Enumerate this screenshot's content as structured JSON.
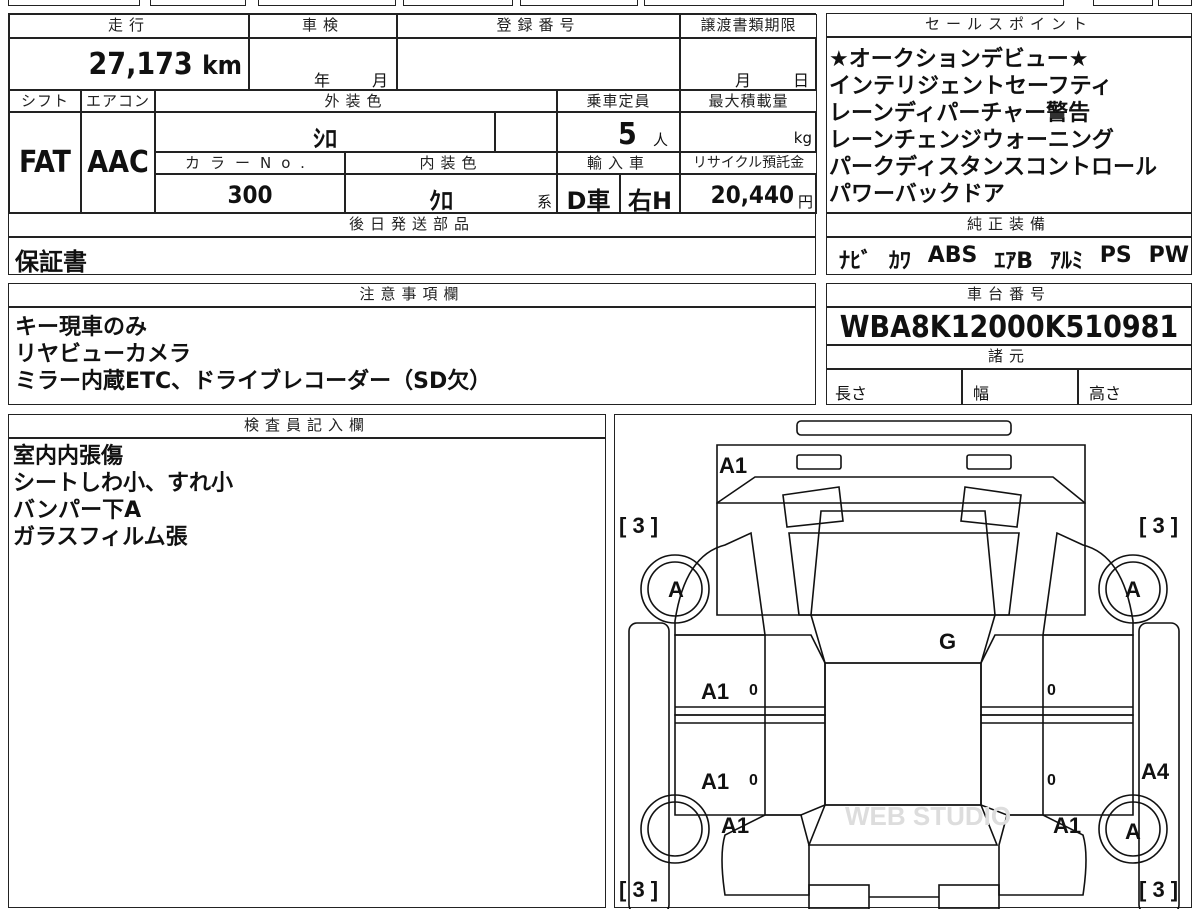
{
  "top": {
    "mileage_label": "走行",
    "mileage_value": "27,173",
    "mileage_unit": "km",
    "inspection_label": "車検",
    "inspection_year": "年",
    "inspection_month": "月",
    "registration_label": "登録番号",
    "registration_value": "",
    "transfer_label": "譲渡書類期限",
    "transfer_month": "月",
    "transfer_day": "日"
  },
  "spec": {
    "shift_label": "シフト",
    "shift_value": "FAT",
    "ac_label": "エアコン",
    "ac_value": "AAC",
    "exterior_label": "外装色",
    "exterior_value": "ｼﾛ",
    "capacity_label": "乗車定員",
    "capacity_value": "5",
    "capacity_unit": "人",
    "load_label": "最大積載量",
    "load_unit": "kg",
    "color_no_label": "カラーNo.",
    "color_no_value": "300",
    "interior_label": "内装色",
    "interior_value": "ｸﾛ",
    "interior_suffix": "系",
    "import_label": "輸入車",
    "import_type": "D車",
    "import_steer": "右H",
    "recycle_label": "リサイクル預託金",
    "recycle_value": "20,440",
    "recycle_unit": "円"
  },
  "sales_points": {
    "label": "セールスポイント",
    "items": [
      "★オークションデビュー★",
      "インテリジェントセーフティ",
      "レーンディパーチャー警告",
      "レーンチェンジウォーニング",
      "パークディスタンスコントロール",
      "パワーバックドア"
    ]
  },
  "parts": {
    "label": "後日発送部品",
    "value": "保証書"
  },
  "equipment": {
    "label": "純正装備",
    "items": [
      "ﾅﾋﾞ",
      "ｶﾜ",
      "ABS",
      "ｴｱB",
      "ｱﾙﾐ",
      "PS",
      "PW"
    ]
  },
  "notes": {
    "label": "注意事項欄",
    "lines": [
      "キー現車のみ",
      "リヤビューカメラ",
      "ミラー内蔵ETC、ドライブレコーダー（SD欠）"
    ]
  },
  "chassis": {
    "label": "車台番号",
    "value": "WBA8K12000K510981"
  },
  "dimensions": {
    "label": "諸元",
    "length": "長さ",
    "width": "幅",
    "height": "高さ"
  },
  "inspector": {
    "label": "検査員記入欄",
    "lines": [
      "室内内張傷",
      "シートしわ小、すれ小",
      "バンパー下A",
      "ガラスフィルム張"
    ]
  },
  "diagram": {
    "marks": {
      "front": "A1",
      "left_front_tire_bracket": "[ 3 ]",
      "right_front_tire_bracket": "[ 3 ]",
      "left_front_wheel": "A",
      "right_front_wheel": "A",
      "windshield": "G",
      "left_front_door": "A1",
      "left_rear_door": "A1",
      "left_rear_fender": "A1",
      "right_rear_fender": "A1",
      "right_quarter": "A4",
      "right_rear_wheel": "A",
      "left_rear_tire_bracket": "[ 3 ]",
      "right_rear_tire_bracket": "[ 3 ]",
      "door_zero": "0"
    },
    "watermark": "WEB STUDIO"
  }
}
